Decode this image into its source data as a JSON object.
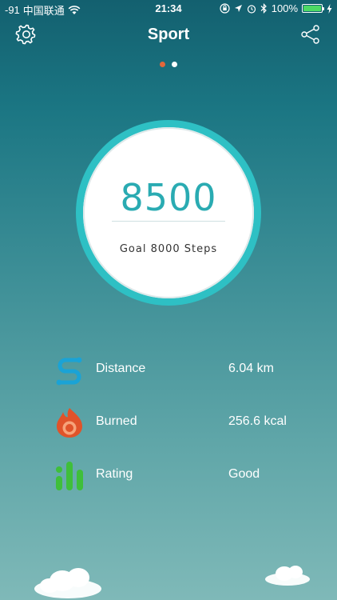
{
  "status_bar": {
    "signal": "-91",
    "carrier": "中国联通",
    "time": "21:34",
    "battery": "100%",
    "wifi_icon": "wifi-icon",
    "battery_color": "#4cd964"
  },
  "nav": {
    "title": "Sport",
    "left_icon": "gear-icon",
    "right_icon": "share-icon"
  },
  "pager": {
    "count": 2,
    "active_index": 0,
    "active_color": "#e2673a"
  },
  "steps": {
    "count": "8500",
    "goal_label": "Goal 8000 Steps",
    "ring_color": "#2ec0c4",
    "digit_color": "#2aabb2"
  },
  "stats": [
    {
      "icon": "distance-icon",
      "label": "Distance",
      "value": "6.04 km"
    },
    {
      "icon": "flame-icon",
      "label": "Burned",
      "value": "256.6 kcal"
    },
    {
      "icon": "bar-chart-icon",
      "label": "Rating",
      "value": "Good"
    }
  ]
}
